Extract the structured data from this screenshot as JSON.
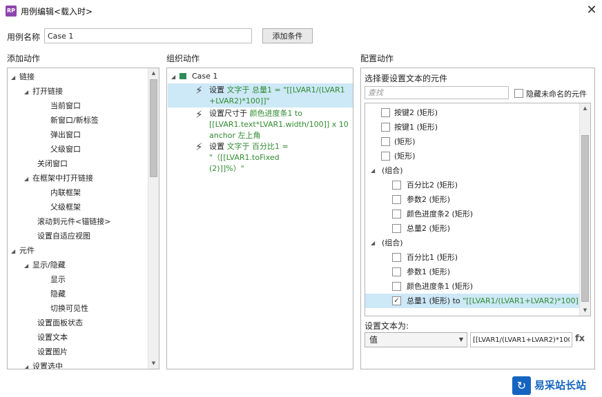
{
  "window": {
    "title": "用例编辑<载入时>",
    "app_icon": "RP"
  },
  "case": {
    "name_label": "用例名称",
    "name_value": "Case 1",
    "add_condition_label": "添加条件"
  },
  "headers": {
    "add_action": "添加动作",
    "organize_action": "组织动作",
    "configure_action": "配置动作"
  },
  "add_action_tree": [
    {
      "label": "链接"
    },
    {
      "label": "打开链接"
    },
    {
      "label": "当前窗口"
    },
    {
      "label": "新窗口/新标签"
    },
    {
      "label": "弹出窗口"
    },
    {
      "label": "父级窗口"
    },
    {
      "label": "关闭窗口"
    },
    {
      "label": "在框架中打开链接"
    },
    {
      "label": "内联框架"
    },
    {
      "label": "父级框架"
    },
    {
      "label": "滚动到元件<锚链接>"
    },
    {
      "label": "设置自适应视图"
    },
    {
      "label": "元件"
    },
    {
      "label": "显示/隐藏"
    },
    {
      "label": "显示"
    },
    {
      "label": "隐藏"
    },
    {
      "label": "切换可见性"
    },
    {
      "label": "设置面板状态"
    },
    {
      "label": "设置文本"
    },
    {
      "label": "设置图片"
    },
    {
      "label": "设置选中"
    }
  ],
  "organize": {
    "case_label": "Case 1",
    "actions": [
      {
        "lines": [
          {
            "a": "设置 ",
            "b": "文字于 总量1 = \"[[LVAR1/(LVAR1"
          },
          {
            "a": "",
            "b": "+LVAR2)*100]]\""
          }
        ]
      },
      {
        "lines": [
          {
            "a": "设置尺寸于 ",
            "b": "颜色进度条1 to"
          },
          {
            "a": "",
            "b": "[[LVAR1.text*LVAR1.width/100]] x 10"
          },
          {
            "a": "",
            "b": "anchor 左上角"
          }
        ]
      },
      {
        "lines": [
          {
            "a": "设置 ",
            "b": "文字于 百分比1 = \"（[[LVAR1.toFixed"
          },
          {
            "a": "",
            "b": "(2)]]%）\""
          }
        ]
      }
    ]
  },
  "configure": {
    "select_label": "选择要设置文本的元件",
    "search_placeholder": "查找",
    "hide_unnamed_label": "隐藏未命名的元件",
    "widgets": [
      {
        "label": "按键2 (矩形)"
      },
      {
        "label": "按键1 (矩形)"
      },
      {
        "label": "(矩形)"
      },
      {
        "label": "(矩形)"
      },
      {
        "label": "(组合)"
      },
      {
        "label": "百分比2 (矩形)"
      },
      {
        "label": "参数2 (矩形)"
      },
      {
        "label": "颜色进度条2 (矩形)"
      },
      {
        "label": "总量2 (矩形)"
      },
      {
        "label": "(组合)"
      },
      {
        "label": "百分比1 (矩形)"
      },
      {
        "label": "参数1 (矩形)"
      },
      {
        "label": "颜色进度条1 (矩形)"
      },
      {
        "label": "总量1 (矩形) to ",
        "value": "\"[[LVAR1/(LVAR1+LVAR2)*100]]\""
      }
    ],
    "set_text_label": "设置文本为:",
    "value_type": "值",
    "value_text": "[[LVAR1/(LVAR1+LVAR2)*100]]",
    "fx_label": "fx"
  },
  "watermark": {
    "text": "易采站长站"
  },
  "colors": {
    "selection": "#cde8f7",
    "green_text": "#2e8b2e",
    "app_icon": "#8e44ad"
  }
}
